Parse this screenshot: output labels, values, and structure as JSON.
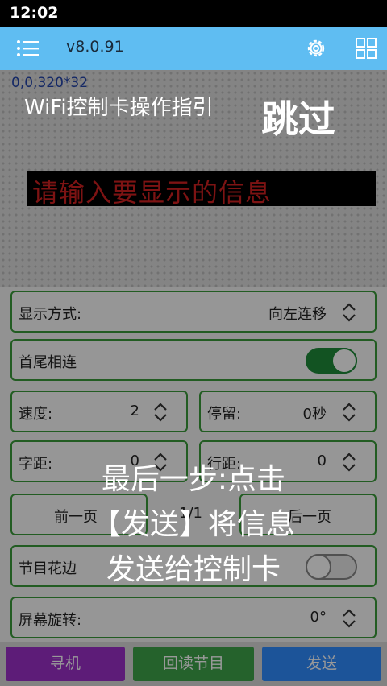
{
  "status": {
    "time": "12:02"
  },
  "appbar": {
    "version": "v8.0.91"
  },
  "preview": {
    "size_readout": "0,0,320*32",
    "led_text": "请输入要显示的信息"
  },
  "settings": {
    "display_mode": {
      "label": "显示方式:",
      "value": "向左连移"
    },
    "head_tail": {
      "label": "首尾相连",
      "on": true
    },
    "speed": {
      "label": "速度:",
      "value": "2"
    },
    "stay": {
      "label": "停留:",
      "value": "0秒"
    },
    "char_spacing": {
      "label": "字距:",
      "value": "0"
    },
    "line_spacing": {
      "label": "行距:",
      "value": "0"
    },
    "page_nav": {
      "prev": "前一页",
      "page": "1/1",
      "next": "后一页"
    },
    "border": {
      "label": "节目花边",
      "on": false
    },
    "rotation": {
      "label": "屏幕旋转:",
      "value": "0°"
    }
  },
  "bottom": {
    "search": "寻机",
    "readback": "回读节目",
    "send": "发送"
  },
  "guide": {
    "title": "WiFi控制卡操作指引",
    "skip": "跳过",
    "line1": "最后一步:点击",
    "line2": "【发送】将信息",
    "line3": "发送给控制卡"
  },
  "colors": {
    "accent": "#5fbdf2",
    "toggle_on": "#1f8a3a",
    "search_btn": "#9b30c8",
    "readback_btn": "#3ea34a",
    "send_btn": "#2f8cff"
  }
}
